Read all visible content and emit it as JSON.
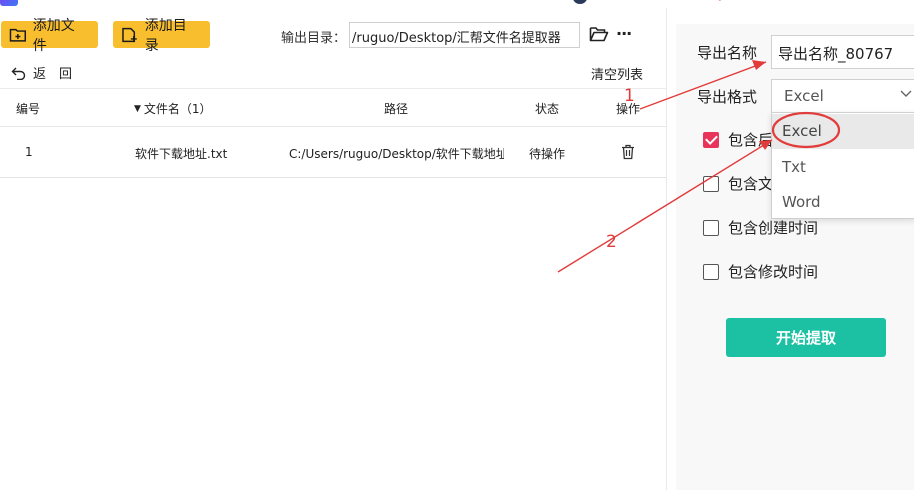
{
  "toolbar": {
    "add_file": "添加文件",
    "add_folder": "添加目录",
    "output_label": "输出目录：",
    "output_value": "/ruguo/Desktop/汇帮文件名提取器",
    "more": "···"
  },
  "list": {
    "back": "返　回",
    "clear": "清空列表",
    "columns": [
      "编号",
      "文件名（1）",
      "路径",
      "状态",
      "操作"
    ],
    "rows": [
      {
        "index": "1",
        "name": "软件下载地址.txt",
        "path": "C:/Users/ruguo/Desktop/软件下载地址",
        "status": "待操作"
      }
    ]
  },
  "panel": {
    "name_label": "导出名称",
    "name_value": "导出名称_80767",
    "format_label": "导出格式",
    "format_value": "Excel",
    "format_options": [
      "Excel",
      "Txt",
      "Word"
    ],
    "checkboxes": [
      {
        "label": "包含后缀",
        "checked": true
      },
      {
        "label": "包含文件大小",
        "checked": false
      },
      {
        "label": "包含创建时间",
        "checked": false
      },
      {
        "label": "包含修改时间",
        "checked": false
      }
    ],
    "start": "开始提取"
  },
  "annotations": {
    "one": "1",
    "two": "2"
  },
  "colors": {
    "accent_yellow": "#f8be2e",
    "primary": "#1cc1a4",
    "check": "#e8345b",
    "annotation": "#e23b3b"
  }
}
